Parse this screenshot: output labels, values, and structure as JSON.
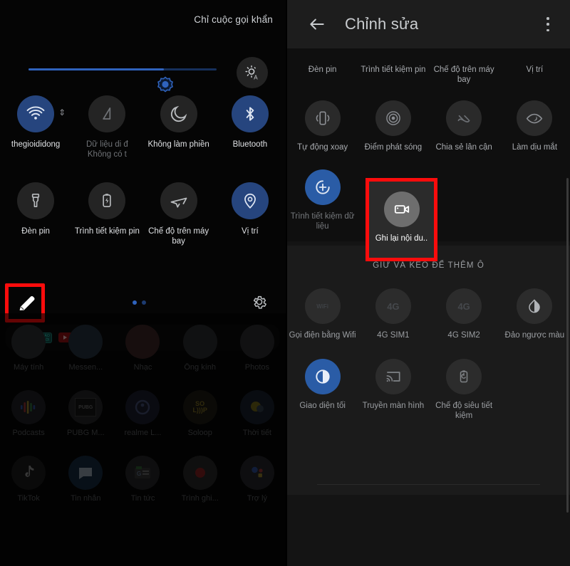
{
  "left_panel": {
    "status_text": "Chỉ cuộc gọi khẩn",
    "brightness": {
      "icon": "brightness-auto-icon",
      "slider_value_pct": 72
    },
    "tiles_row1": [
      {
        "label": "thegioididong",
        "icon": "wifi-icon",
        "state": "on"
      },
      {
        "label": "Dữ liệu di đ\nKhông có t",
        "icon": "mobile-data-icon",
        "state": "off"
      },
      {
        "label": "Không làm phiền",
        "icon": "do-not-disturb-moon-icon",
        "state": "off"
      },
      {
        "label": "Bluetooth",
        "icon": "bluetooth-icon",
        "state": "on"
      }
    ],
    "tiles_row2": [
      {
        "label": "Đèn pin",
        "icon": "flashlight-icon",
        "state": "off"
      },
      {
        "label": "Trình tiết kiệm pin",
        "icon": "battery-saver-icon",
        "state": "off"
      },
      {
        "label": "Chế độ trên máy bay",
        "icon": "airplane-icon",
        "state": "off"
      },
      {
        "label": "Vị trí",
        "icon": "location-pin-icon",
        "state": "on"
      }
    ],
    "footer": {
      "edit_button": "pencil-edit-icon",
      "settings_button": "gear-icon",
      "page_dots": 2,
      "active_dot_index": 0
    },
    "notification_icons": [
      "gear-icon",
      "bao-moi-icon",
      "youtube-icon"
    ],
    "home_apps_row_partial": [
      "Máy tính",
      "Messen...",
      "Nhạc",
      "Ống kính",
      "Photos"
    ],
    "home_apps_row2": [
      "Podcasts",
      "PUBG M...",
      "realme L...",
      "Soloop",
      "Thời tiết"
    ],
    "home_apps_row3": [
      "TikTok",
      "Tin nhắn",
      "Tin tức",
      "Trình ghi...",
      "Trợ lý"
    ]
  },
  "right_panel": {
    "appbar": {
      "back_icon": "back-arrow-icon",
      "title": "Chỉnh sửa",
      "overflow_icon": "more-vertical-icon"
    },
    "active_labels_row": [
      "Đèn pin",
      "Trình tiết kiệm pin",
      "Chế độ trên máy bay",
      "Vị trí"
    ],
    "active_tiles_row2": [
      {
        "label": "Tự động xoay",
        "icon": "auto-rotate-icon",
        "state": "off"
      },
      {
        "label": "Điểm phát sóng",
        "icon": "hotspot-icon",
        "state": "off"
      },
      {
        "label": "Chia sẻ lân cận",
        "icon": "nearby-share-icon",
        "state": "off"
      },
      {
        "label": "Làm dịu mắt",
        "icon": "eye-comfort-icon",
        "state": "off"
      }
    ],
    "active_tiles_row3": [
      {
        "label": "Trình tiết kiệm dữ liệu",
        "icon": "data-saver-icon",
        "state": "on"
      },
      {
        "label": "Ghi lại nội du..",
        "icon": "screen-record-icon",
        "state": "highlighted"
      }
    ],
    "add_section": {
      "title": "GIỮ VÀ KÉO ĐỂ THÊM Ô",
      "tiles": [
        {
          "label": "Gọi điện bằng Wifi",
          "icon": "wifi-calling-icon",
          "badge": "WiFi",
          "state": "off"
        },
        {
          "label": "4G SIM1",
          "icon": "sim1-4g-icon",
          "badge": "4G",
          "state": "off"
        },
        {
          "label": "4G SIM2",
          "icon": "sim2-4g-icon",
          "badge": "4G",
          "state": "off"
        },
        {
          "label": "Đảo ngược màu",
          "icon": "invert-colors-icon",
          "state": "off"
        },
        {
          "label": "Giao diện tối",
          "icon": "dark-theme-icon",
          "state": "on"
        },
        {
          "label": "Truyền màn hình",
          "icon": "cast-screen-icon",
          "state": "off"
        },
        {
          "label": "Chế độ siêu tiết kiệm",
          "icon": "super-saver-icon",
          "state": "off"
        }
      ]
    }
  },
  "colors": {
    "accent_blue": "#2a5ca6",
    "accent_blue_dim": "#26457e",
    "highlight_red": "#fb0c0c",
    "tile_off": "#2a2a2a",
    "panel_bg": "#141414"
  }
}
